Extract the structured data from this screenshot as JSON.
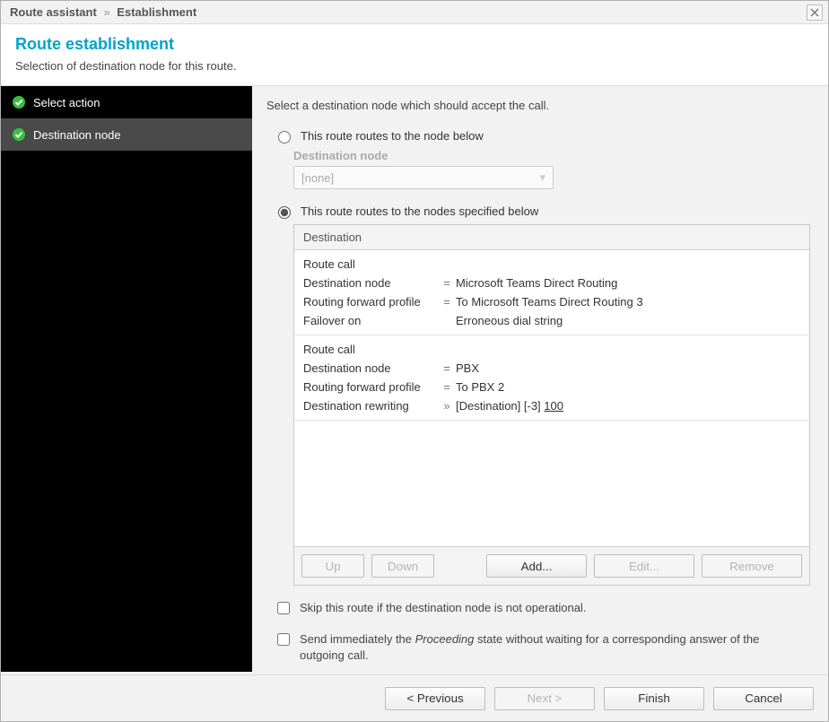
{
  "window": {
    "breadcrumb": [
      "Route assistant",
      "Establishment"
    ]
  },
  "header": {
    "title": "Route establishment",
    "subtitle": "Selection of destination node for this route."
  },
  "sidebar": {
    "items": [
      {
        "label": "Select action",
        "done": true,
        "active": false
      },
      {
        "label": "Destination node",
        "done": true,
        "active": true
      }
    ]
  },
  "main": {
    "instruction": "Select a destination node which should accept the call.",
    "option_single": {
      "label": "This route routes to the node below",
      "field_label": "Destination node",
      "value": "[none]",
      "selected": false
    },
    "option_multi": {
      "label": "This route routes to the nodes specified below",
      "selected": true,
      "table_header": "Destination",
      "rows": [
        {
          "title": "Route call",
          "kv": [
            {
              "k": "Destination node",
              "op": "=",
              "v": "Microsoft Teams Direct Routing"
            },
            {
              "k": "Routing forward profile",
              "op": "=",
              "v": "To Microsoft Teams Direct Routing 3"
            },
            {
              "k": "Failover on",
              "op": "",
              "v": "Erroneous dial string"
            }
          ]
        },
        {
          "title": "Route call",
          "kv": [
            {
              "k": "Destination node",
              "op": "=",
              "v": "PBX"
            },
            {
              "k": "Routing forward profile",
              "op": "=",
              "v": "To PBX 2"
            },
            {
              "k": "Destination rewriting",
              "op": "»",
              "v_prefix": "[Destination] [-3] ",
              "v_underlined": "100"
            }
          ]
        }
      ],
      "buttons": {
        "up": "Up",
        "down": "Down",
        "add": "Add...",
        "edit": "Edit...",
        "remove": "Remove"
      }
    },
    "checkboxes": {
      "skip": "Skip this route if the destination node is not operational.",
      "proceed_pre": "Send immediately the ",
      "proceed_em": "Proceeding",
      "proceed_post": " state without waiting for a corresponding answer of the outgoing call."
    }
  },
  "footer": {
    "previous": "< Previous",
    "next": "Next >",
    "finish": "Finish",
    "cancel": "Cancel"
  }
}
